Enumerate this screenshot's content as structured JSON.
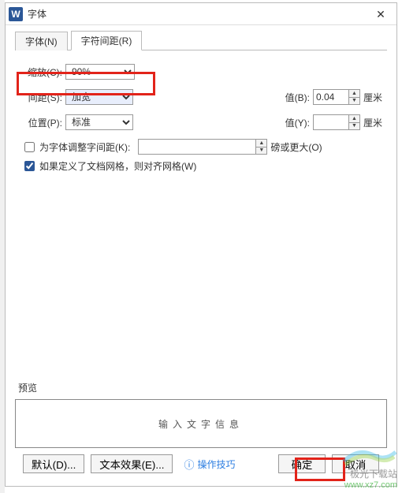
{
  "window": {
    "app_letter": "W",
    "title": "字体"
  },
  "tabs": {
    "font": "字体(N)",
    "spacing": "字符间距(R)"
  },
  "form": {
    "zoom_label": "缩放(C):",
    "zoom_value": "90%",
    "spacing_label": "间距(S):",
    "spacing_value": "加宽",
    "value_b_label": "值(B):",
    "value_b_value": "0.04",
    "value_b_unit": "厘米",
    "position_label": "位置(P):",
    "position_value": "标准",
    "value_y_label": "值(Y):",
    "value_y_value": "",
    "value_y_unit": "厘米",
    "kerning_label": "为字体调整字间距(K):",
    "kerning_value": "",
    "kerning_unit": "磅或更大(O)",
    "snap_label": "如果定义了文档网格，则对齐网格(W)"
  },
  "preview": {
    "title": "预览",
    "placeholder_text": "输入文字信息"
  },
  "footer": {
    "default_btn": "默认(D)...",
    "text_effect_btn": "文本效果(E)...",
    "tips": "操作技巧",
    "ok": "确定",
    "cancel": "取消"
  },
  "watermark": {
    "line1": "极光下载站",
    "line2": "www.xz7.com"
  }
}
